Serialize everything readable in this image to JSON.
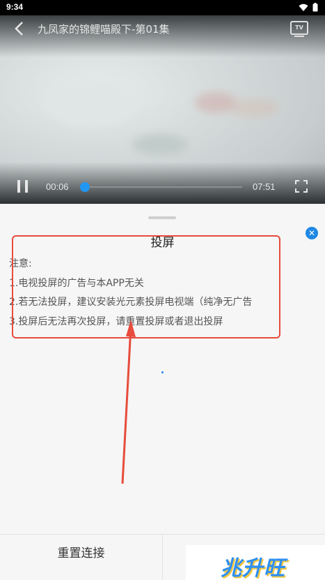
{
  "status_bar": {
    "time": "9:34",
    "icons": [
      "wifi-icon",
      "battery-icon"
    ]
  },
  "video": {
    "title": "九凤家的锦鲤喵殿下-第01集",
    "tv_label": "TV",
    "current_time": "00:06",
    "duration": "07:51",
    "progress": 0.013
  },
  "sheet": {
    "title": "投屏",
    "notes": [
      "注意:",
      "1.电视投屏的广告与本APP无关",
      "2.若无法投屏，建议安装光元素投屏电视端（纯净无广告",
      "3.投屏后无法再次投屏，请重置投屏或者退出投屏"
    ],
    "reset_label": "重置连接"
  },
  "watermark": {
    "text": "兆升旺"
  },
  "colors": {
    "accent": "#1e88e5",
    "annotation": "#e74c3c"
  }
}
